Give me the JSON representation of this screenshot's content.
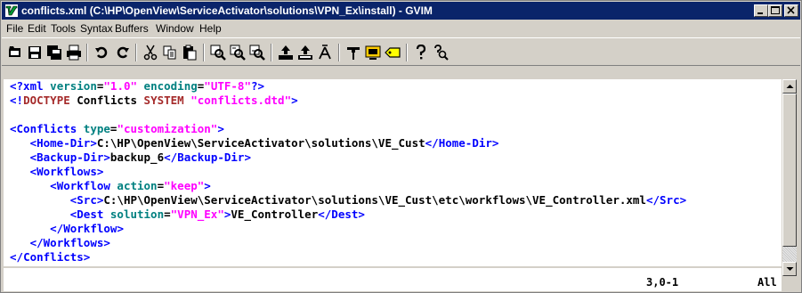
{
  "window": {
    "title": "conflicts.xml (C:\\HP\\OpenView\\ServiceActivator\\solutions\\VPN_Ex\\install) - GVIM"
  },
  "menu": [
    "File",
    "Edit",
    "Tools",
    "Syntax",
    "Buffers",
    "Window",
    "Help"
  ],
  "toolbar_icons": [
    "open-icon",
    "save-icon",
    "save-all-icon",
    "print-icon",
    "undo-icon",
    "redo-icon",
    "cut-icon",
    "copy-icon",
    "paste-icon",
    "find-replace-icon",
    "find-next-icon",
    "find-prev-icon",
    "load-session-icon",
    "save-session-icon",
    "run-script-icon",
    "make-icon",
    "shell-icon",
    "run-ctags-icon",
    "help-icon",
    "find-help-icon"
  ],
  "code": {
    "l1": {
      "d1": "<?xml",
      "a1": " version",
      "eq1": "=",
      "s1": "\"1.0\"",
      "a2": " encoding",
      "eq2": "=",
      "s2": "\"UTF-8\"",
      "d2": "?>"
    },
    "l2": {
      "d1": "<!",
      "kw": "DOCTYPE",
      "t": " Conflicts ",
      "kw2": "SYSTEM",
      "s": " \"conflicts.dtd\"",
      "d2": ">"
    },
    "l4": {
      "o": "<",
      "tag": "Conflicts",
      "a": " type",
      "eq": "=",
      "s": "\"customization\"",
      "c": ">"
    },
    "l5": {
      "o": "<",
      "tag": "Home-Dir",
      "c": ">",
      "text": "C:\\HP\\OpenView\\ServiceActivator\\solutions\\VE_Cust",
      "o2": "</",
      "tag2": "Home-Dir",
      "c2": ">"
    },
    "l6": {
      "o": "<",
      "tag": "Backup-Dir",
      "c": ">",
      "text": "backup_6",
      "o2": "</",
      "tag2": "Backup-Dir",
      "c2": ">"
    },
    "l7": {
      "o": "<",
      "tag": "Workflows",
      "c": ">"
    },
    "l8": {
      "o": "<",
      "tag": "Workflow",
      "a": " action",
      "eq": "=",
      "s": "\"keep\"",
      "c": ">"
    },
    "l9": {
      "o": "<",
      "tag": "Src",
      "c": ">",
      "text": "C:\\HP\\OpenView\\ServiceActivator\\solutions\\VE_Cust\\etc\\workflows\\VE_Controller.xml",
      "o2": "</",
      "tag2": "Src",
      "c2": ">"
    },
    "l10": {
      "o": "<",
      "tag": "Dest",
      "a": " solution",
      "eq": "=",
      "s": "\"VPN_Ex\"",
      "c": ">",
      "text": "VE_Controller",
      "o2": "</",
      "tag2": "Dest",
      "c2": ">"
    },
    "l11": {
      "o": "</",
      "tag": "Workflow",
      "c": ">"
    },
    "l12": {
      "o": "</",
      "tag": "Workflows",
      "c": ">"
    },
    "l13": {
      "o": "</",
      "tag": "Conflicts",
      "c": ">"
    }
  },
  "status": {
    "position": "3,0-1",
    "scroll": "All"
  },
  "colors": {
    "titlebar": "#0a246a",
    "tag": "#0000ff",
    "attr": "#008080",
    "string": "#ff00ff",
    "keyword": "#a52a2a"
  }
}
